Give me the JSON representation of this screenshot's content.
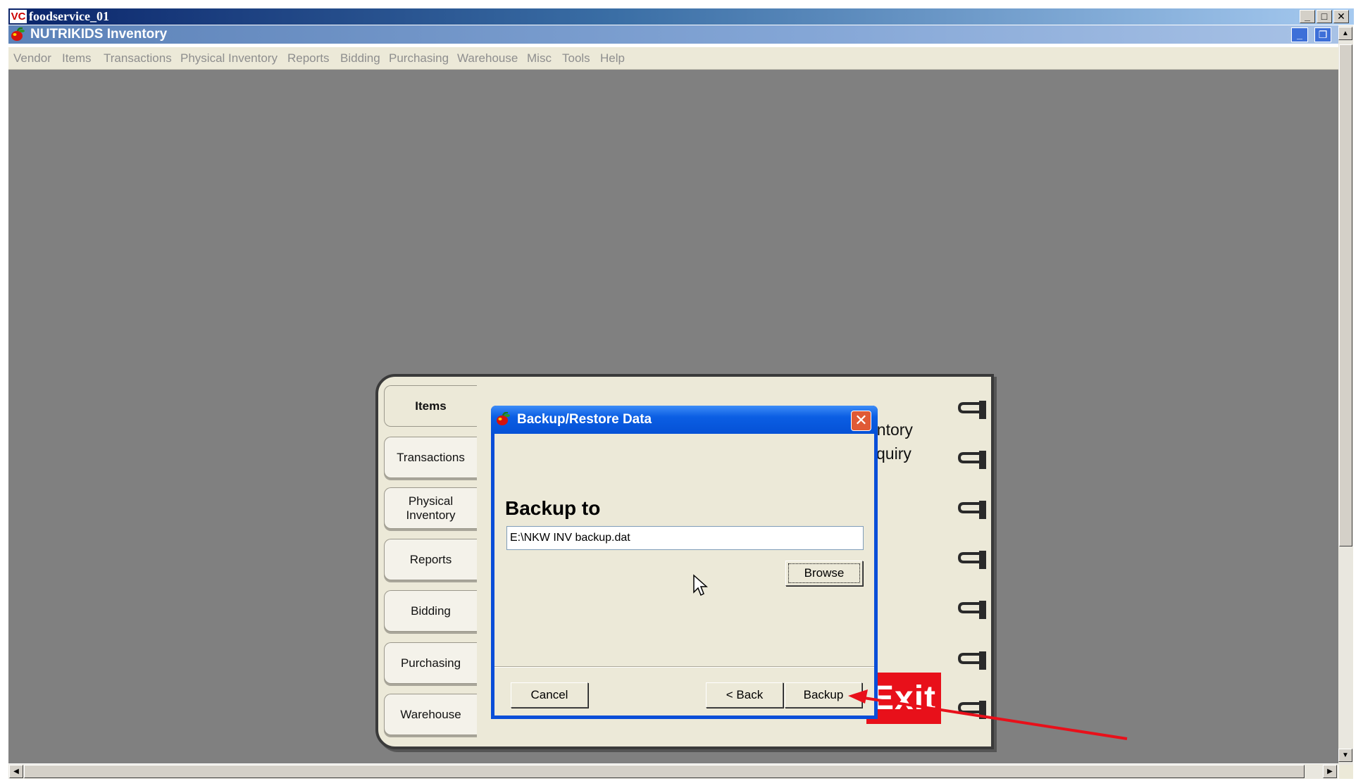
{
  "outer_window": {
    "app_icon_text": "VC",
    "title": "foodservice_01"
  },
  "child_window": {
    "title": "NUTRIKIDS Inventory"
  },
  "menu": {
    "items": [
      "Vendor",
      "Items",
      "Transactions",
      "Physical Inventory",
      "Reports",
      "Bidding",
      "Purchasing",
      "Warehouse",
      "Misc",
      "Tools",
      "Help"
    ]
  },
  "notebook": {
    "tabs": [
      {
        "label": "Items",
        "active": true
      },
      {
        "label": "Transactions"
      },
      {
        "label": "Physical Inventory"
      },
      {
        "label": "Reports"
      },
      {
        "label": "Bidding"
      },
      {
        "label": "Purchasing"
      },
      {
        "label": "Warehouse"
      }
    ],
    "background_labels": [
      "entory",
      "quiry"
    ],
    "exit_label": "Exit"
  },
  "dialog": {
    "title": "Backup/Restore Data",
    "close_symbol": "✕",
    "heading": "Backup to",
    "path_value": "E:\\NKW INV backup.dat",
    "browse_label": "Browse",
    "cancel_label": "Cancel",
    "back_label": "< Back",
    "backup_label": "Backup"
  },
  "colors": {
    "exit_red": "#e8101a",
    "annotation_arrow": "#e8101a",
    "dialog_blue": "#0a4ed8",
    "workspace_gray": "#808080"
  }
}
